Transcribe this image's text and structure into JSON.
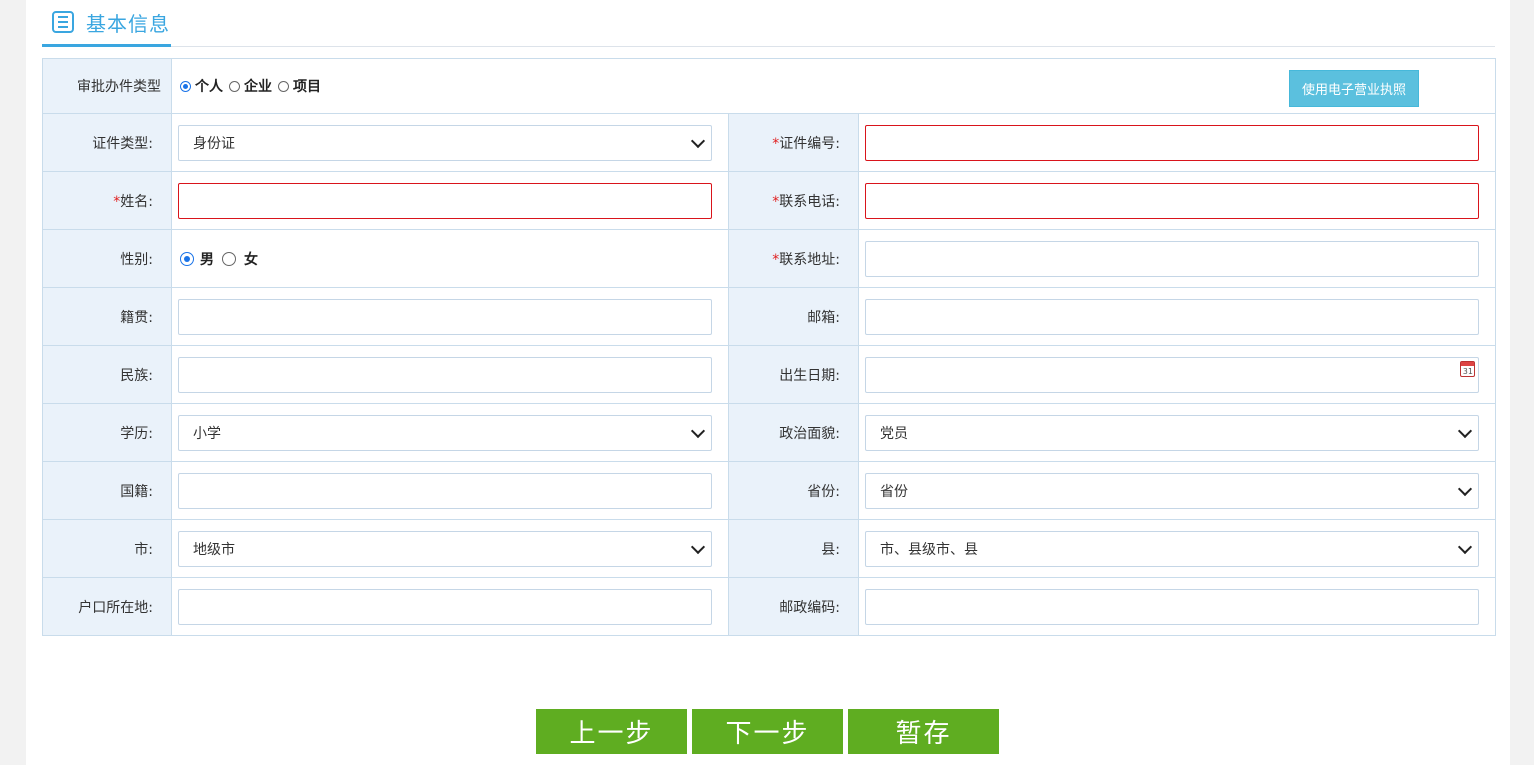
{
  "section": {
    "title": "基本信息",
    "icon": "list-icon"
  },
  "approval_type": {
    "label": "审批办件类型",
    "options": [
      "个人",
      "企业",
      "项目"
    ],
    "selected": "个人",
    "license_button": "使用电子营业执照"
  },
  "fields": {
    "id_type": {
      "label": "证件类型:",
      "value": "身份证"
    },
    "id_number": {
      "required": "*",
      "label": "证件编号:",
      "value": ""
    },
    "name": {
      "required": "*",
      "label": "姓名:",
      "value": ""
    },
    "phone": {
      "required": "*",
      "label": "联系电话:",
      "value": ""
    },
    "gender": {
      "label": "性别:",
      "options": [
        "男",
        "女"
      ],
      "selected": "男"
    },
    "address": {
      "required": "*",
      "label": "联系地址:",
      "value": ""
    },
    "native_place": {
      "label": "籍贯:",
      "value": ""
    },
    "email": {
      "label": "邮箱:",
      "value": ""
    },
    "ethnicity": {
      "label": "民族:",
      "value": ""
    },
    "birth_date": {
      "label": "出生日期:",
      "value": "",
      "icon": "calendar-icon",
      "icon_text": "31"
    },
    "education": {
      "label": "学历:",
      "value": "小学"
    },
    "political_status": {
      "label": "政治面貌:",
      "value": "党员"
    },
    "nationality": {
      "label": "国籍:",
      "value": ""
    },
    "province": {
      "label": "省份:",
      "value": "省份"
    },
    "city": {
      "label": "市:",
      "value": "地级市"
    },
    "county": {
      "label": "县:",
      "value": "市、县级市、县"
    },
    "household": {
      "label": "户口所在地:",
      "value": ""
    },
    "postcode": {
      "label": "邮政编码:",
      "value": ""
    }
  },
  "actions": {
    "prev": "上一步",
    "next": "下一步",
    "save": "暂存"
  },
  "colors": {
    "accent": "#3aa6e0",
    "label_bg": "#eaf2fa",
    "button_green": "#5fad21",
    "error_border": "#d9141b",
    "license_btn": "#5bc0de"
  }
}
